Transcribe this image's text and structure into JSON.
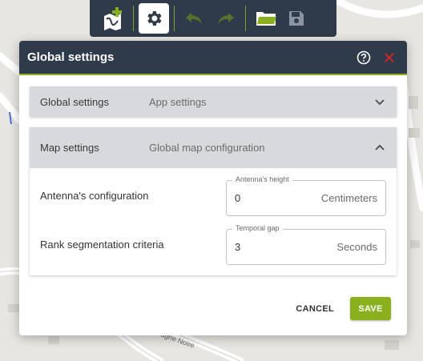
{
  "toolbar": {
    "buttons": [
      {
        "name": "add-map-icon",
        "active": false,
        "enabled": true
      },
      {
        "name": "gear-icon",
        "active": true,
        "enabled": true
      },
      {
        "name": "undo-icon",
        "active": false,
        "enabled": false
      },
      {
        "name": "redo-icon",
        "active": false,
        "enabled": false
      },
      {
        "name": "open-folder-icon",
        "active": false,
        "enabled": true
      },
      {
        "name": "save-disk-icon",
        "active": false,
        "enabled": false
      }
    ]
  },
  "map": {
    "street_label": "agne Noire"
  },
  "dialog": {
    "title": "Global settings",
    "sections": [
      {
        "title": "Global settings",
        "subtitle": "App settings",
        "expanded": false
      },
      {
        "title": "Map settings",
        "subtitle": "Global map configuration",
        "expanded": true
      }
    ],
    "fields": [
      {
        "label": "Antenna's configuration",
        "legend": "Antenna's height",
        "value": "0",
        "unit": "Centimeters"
      },
      {
        "label": "Rank segmentation criteria",
        "legend": "Temporal gap",
        "value": "3",
        "unit": "Seconds"
      }
    ],
    "cancel_label": "CANCEL",
    "save_label": "SAVE"
  },
  "colors": {
    "header": "#2f3a4a",
    "accent": "#8bb01e",
    "close": "#c62828",
    "panel_head": "#d7d9dd"
  }
}
